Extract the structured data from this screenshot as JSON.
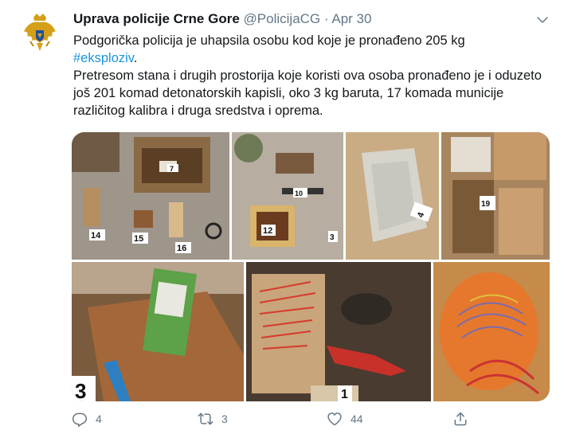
{
  "tweet": {
    "author_name": "Uprava policije Crne Gore",
    "handle": "@PolicijaCG",
    "separator": "·",
    "date": "Apr 30",
    "text_line1": "Podgorička policija je uhapsila osobu kod koje je pronađeno 205 kg",
    "hashtag": "#eksploziv",
    "hashtag_suffix": ".",
    "text_para2": "Pretresom stana i drugih prostorija koje koristi ova osoba pronađeno je i oduzeto još 201 komad detonatorskih kapisli, oko 3 kg baruta, 17 komada municije različitog kalibra i druga sredstva i oprema."
  },
  "photo_markers": [
    "14",
    "15",
    "16",
    "7",
    "12",
    "10",
    "3",
    "4",
    "19",
    "3",
    "1"
  ],
  "actions": {
    "reply_count": "4",
    "retweet_count": "3",
    "like_count": "44"
  },
  "colors": {
    "link": "#1b95e0",
    "secondary_text": "#657786",
    "text": "#14171a"
  },
  "icons": [
    "coat-of-arms-avatar",
    "chevron-down-icon",
    "reply-icon",
    "retweet-icon",
    "like-icon",
    "share-icon"
  ]
}
